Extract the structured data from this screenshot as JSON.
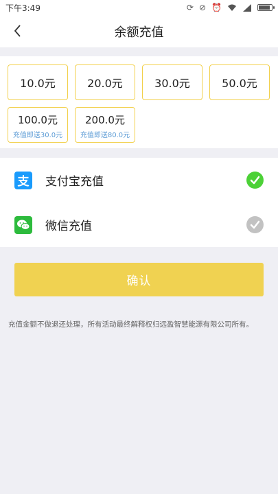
{
  "status_bar": {
    "time": "下午3:49"
  },
  "header": {
    "title": "余额充值"
  },
  "amounts": [
    {
      "value": "10.0元",
      "bonus": ""
    },
    {
      "value": "20.0元",
      "bonus": ""
    },
    {
      "value": "30.0元",
      "bonus": ""
    },
    {
      "value": "50.0元",
      "bonus": ""
    },
    {
      "value": "100.0元",
      "bonus": "充值即送30.0元"
    },
    {
      "value": "200.0元",
      "bonus": "充值即送80.0元"
    }
  ],
  "payment": {
    "alipay": {
      "label": "支付宝充值",
      "icon_text": "支",
      "icon": "alipay-icon",
      "selected": true
    },
    "wechat": {
      "label": "微信充值",
      "icon": "wechat-icon",
      "selected": false
    }
  },
  "confirm_label": "确认",
  "notice": "充值金额不做退还处理，所有活动最终解释权归远盈智慧能源有限公司所有。",
  "colors": {
    "accent_yellow": "#f0d251",
    "border_yellow": "#f2d04a",
    "bonus_blue": "#5b9bd5",
    "check_green": "#4cd137",
    "check_gray": "#c2c2c2",
    "alipay_blue": "#1a9bfc",
    "wechat_green": "#2dbb3d"
  },
  "battery_level": 0.9
}
